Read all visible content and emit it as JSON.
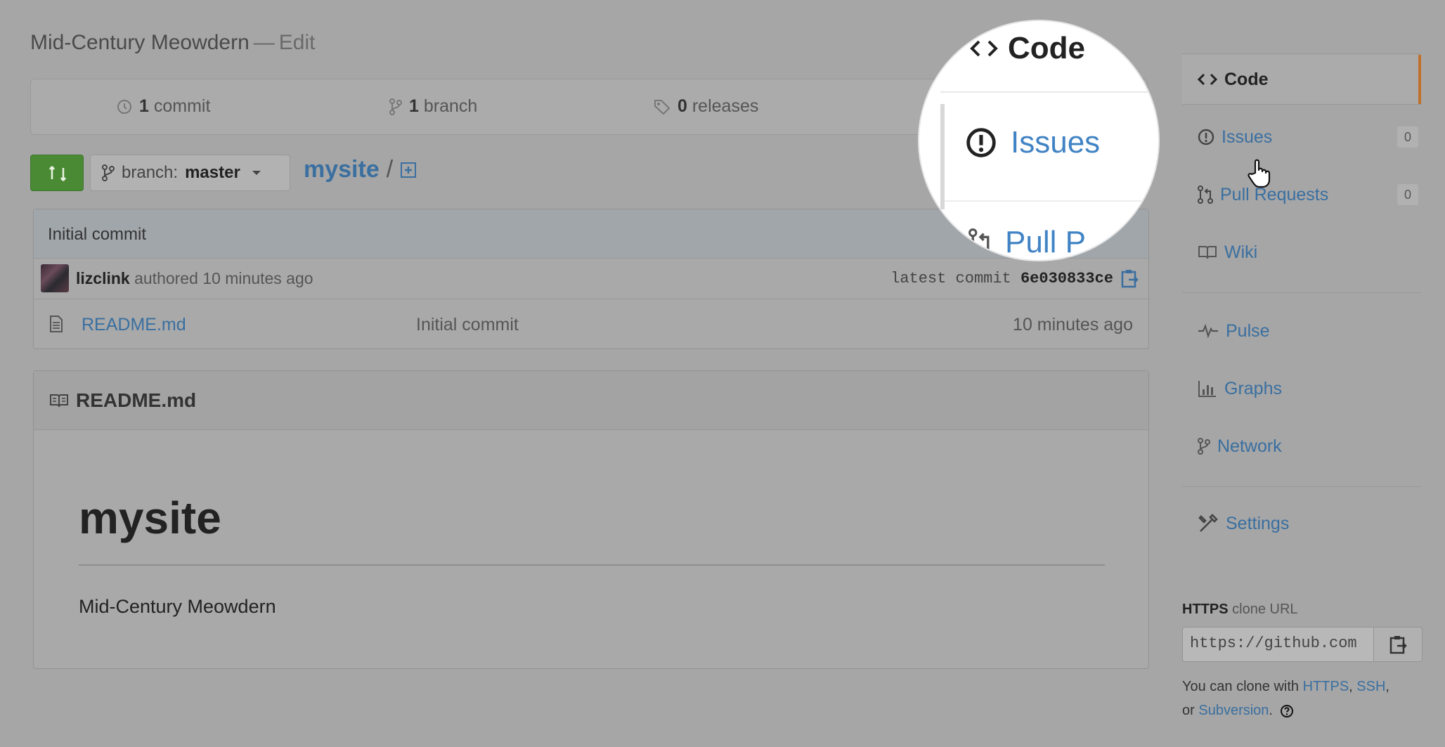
{
  "repo": {
    "title": "Mid-Century Meowdern",
    "separator": "—",
    "edit_label": "Edit"
  },
  "stats": {
    "commits": {
      "count": "1",
      "label": "commit"
    },
    "branches": {
      "count": "1",
      "label": "branch"
    },
    "releases": {
      "count": "0",
      "label": "releases"
    }
  },
  "toolbar": {
    "branch_prefix": "branch:",
    "branch_name": "master",
    "repo_link": "mysite",
    "path_sep": "/"
  },
  "commit": {
    "message": "Initial commit",
    "author": "lizclink",
    "authored_text": "authored 10 minutes ago",
    "latest_label": "latest commit",
    "sha": "6e030833ce"
  },
  "files": [
    {
      "name": "README.md",
      "message": "Initial commit",
      "age": "10 minutes ago"
    }
  ],
  "readme": {
    "header": "README.md",
    "heading": "mysite",
    "paragraph": "Mid-Century Meowdern"
  },
  "sidebar": {
    "code": "Code",
    "issues": "Issues",
    "issues_count": "0",
    "pulls": "Pull Requests",
    "pulls_count": "0",
    "wiki": "Wiki",
    "pulse": "Pulse",
    "graphs": "Graphs",
    "network": "Network",
    "settings": "Settings"
  },
  "clone": {
    "protocol": "HTTPS",
    "label_suffix": "clone URL",
    "url": "https://github.com",
    "help_prefix": "You can clone with",
    "https": "HTTPS",
    "comma": ",",
    "ssh": "SSH",
    "or": "or",
    "subversion": "Subversion",
    "period": "."
  },
  "magnifier": {
    "code": "Code",
    "issues": "Issues",
    "pull": "Pull P"
  },
  "colors": {
    "accent": "#c0702a",
    "link": "#3a6fa0",
    "green": "#4a8a35",
    "overlay": "#a6a6a6"
  }
}
